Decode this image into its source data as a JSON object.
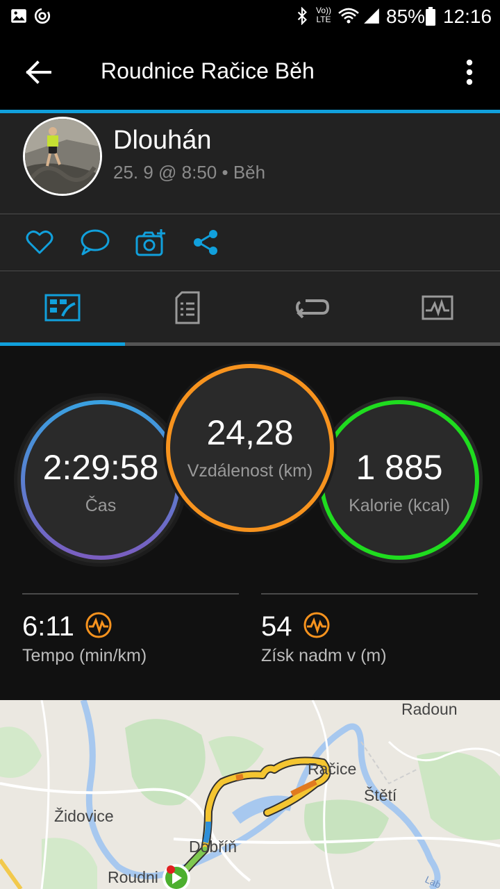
{
  "status_bar": {
    "battery_percent": "85%",
    "time": "12:16",
    "network_label": "LTE",
    "volte_label": "Vo))",
    "icons": [
      "image-icon",
      "sync-icon",
      "bluetooth-icon",
      "wifi-icon",
      "signal-icon",
      "battery-icon"
    ]
  },
  "app_bar": {
    "title": "Roudnice Račice Běh",
    "back_icon": "arrow-left-icon",
    "menu_icon": "more-vert-icon"
  },
  "activity": {
    "user_name": "Dlouhán",
    "meta": "25. 9 @ 8:50 • Běh"
  },
  "social": {
    "icons": [
      "heart-icon",
      "comment-icon",
      "add-photo-icon",
      "share-icon"
    ]
  },
  "tabs": {
    "active_index": 0,
    "items": [
      "stats-tab-icon",
      "details-tab-icon",
      "laps-tab-icon",
      "charts-tab-icon"
    ]
  },
  "stats": {
    "time": {
      "value": "2:29:58",
      "label": "Čas"
    },
    "distance": {
      "value": "24,28",
      "label": "Vzdálenost (km)"
    },
    "calories": {
      "value": "1 885",
      "label": "Kalorie (kcal)"
    },
    "pace": {
      "value": "6:11",
      "label": "Tempo (min/km)"
    },
    "elevation": {
      "value": "54",
      "label": "Získ nadm v (m)"
    }
  },
  "colors": {
    "accent": "#11a0dc",
    "distance_ring": "#f7931e",
    "calories_ring": "#1fdc1f",
    "time_ring_top": "#3aa0e0",
    "time_ring_bottom": "#7a5ec0",
    "metric_icon": "#f7931e"
  },
  "map": {
    "labels": {
      "radoun": "Radoun",
      "racice": "Račice",
      "steti": "Štětí",
      "zidovice": "Židovice",
      "dobrin": "Dobříň",
      "roudnice": "Roudni",
      "river": "Lab"
    }
  }
}
